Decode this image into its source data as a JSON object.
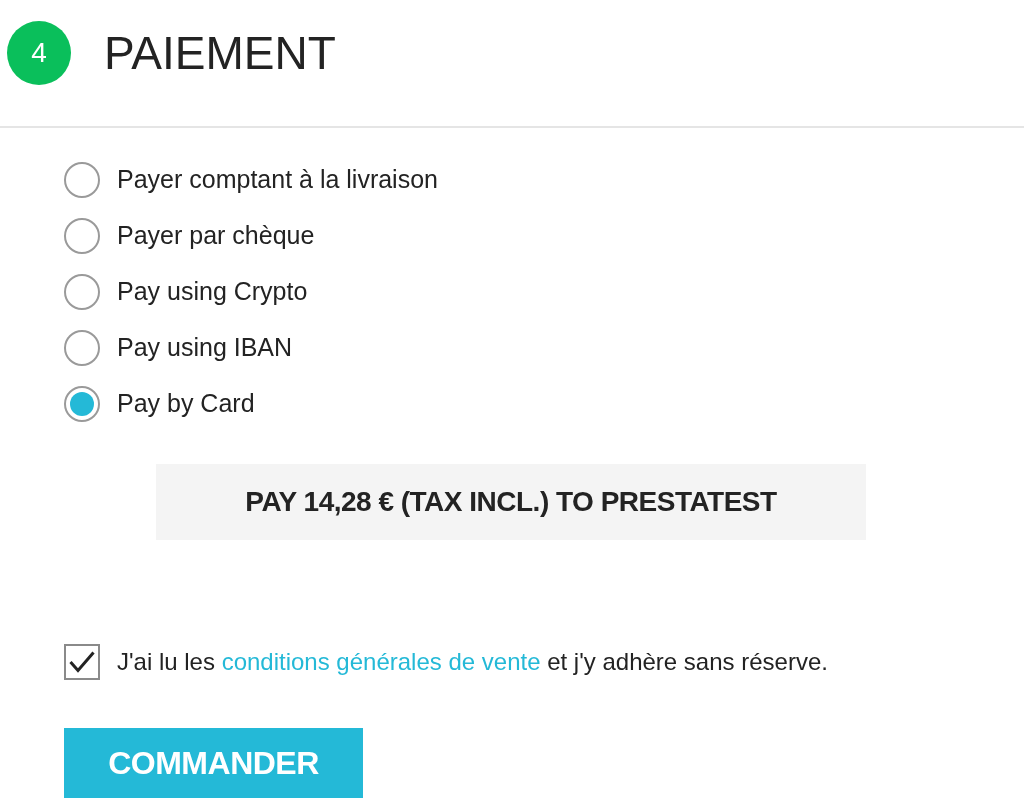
{
  "step": {
    "number": "4",
    "title": "PAIEMENT"
  },
  "payment_options": [
    {
      "label": "Payer comptant à la livraison",
      "selected": false
    },
    {
      "label": "Payer par chèque",
      "selected": false
    },
    {
      "label": "Pay using Crypto",
      "selected": false
    },
    {
      "label": "Pay using IBAN",
      "selected": false
    },
    {
      "label": "Pay by Card",
      "selected": true
    }
  ],
  "pay_button": {
    "label": "PAY 14,28 € (TAX INCL.) TO PRESTATEST"
  },
  "terms": {
    "checked": true,
    "text_before": "J'ai lu les",
    "link": "conditions générales de vente",
    "text_after": "et j'y adhère sans réserve."
  },
  "order_button": {
    "label": "COMMANDER"
  }
}
